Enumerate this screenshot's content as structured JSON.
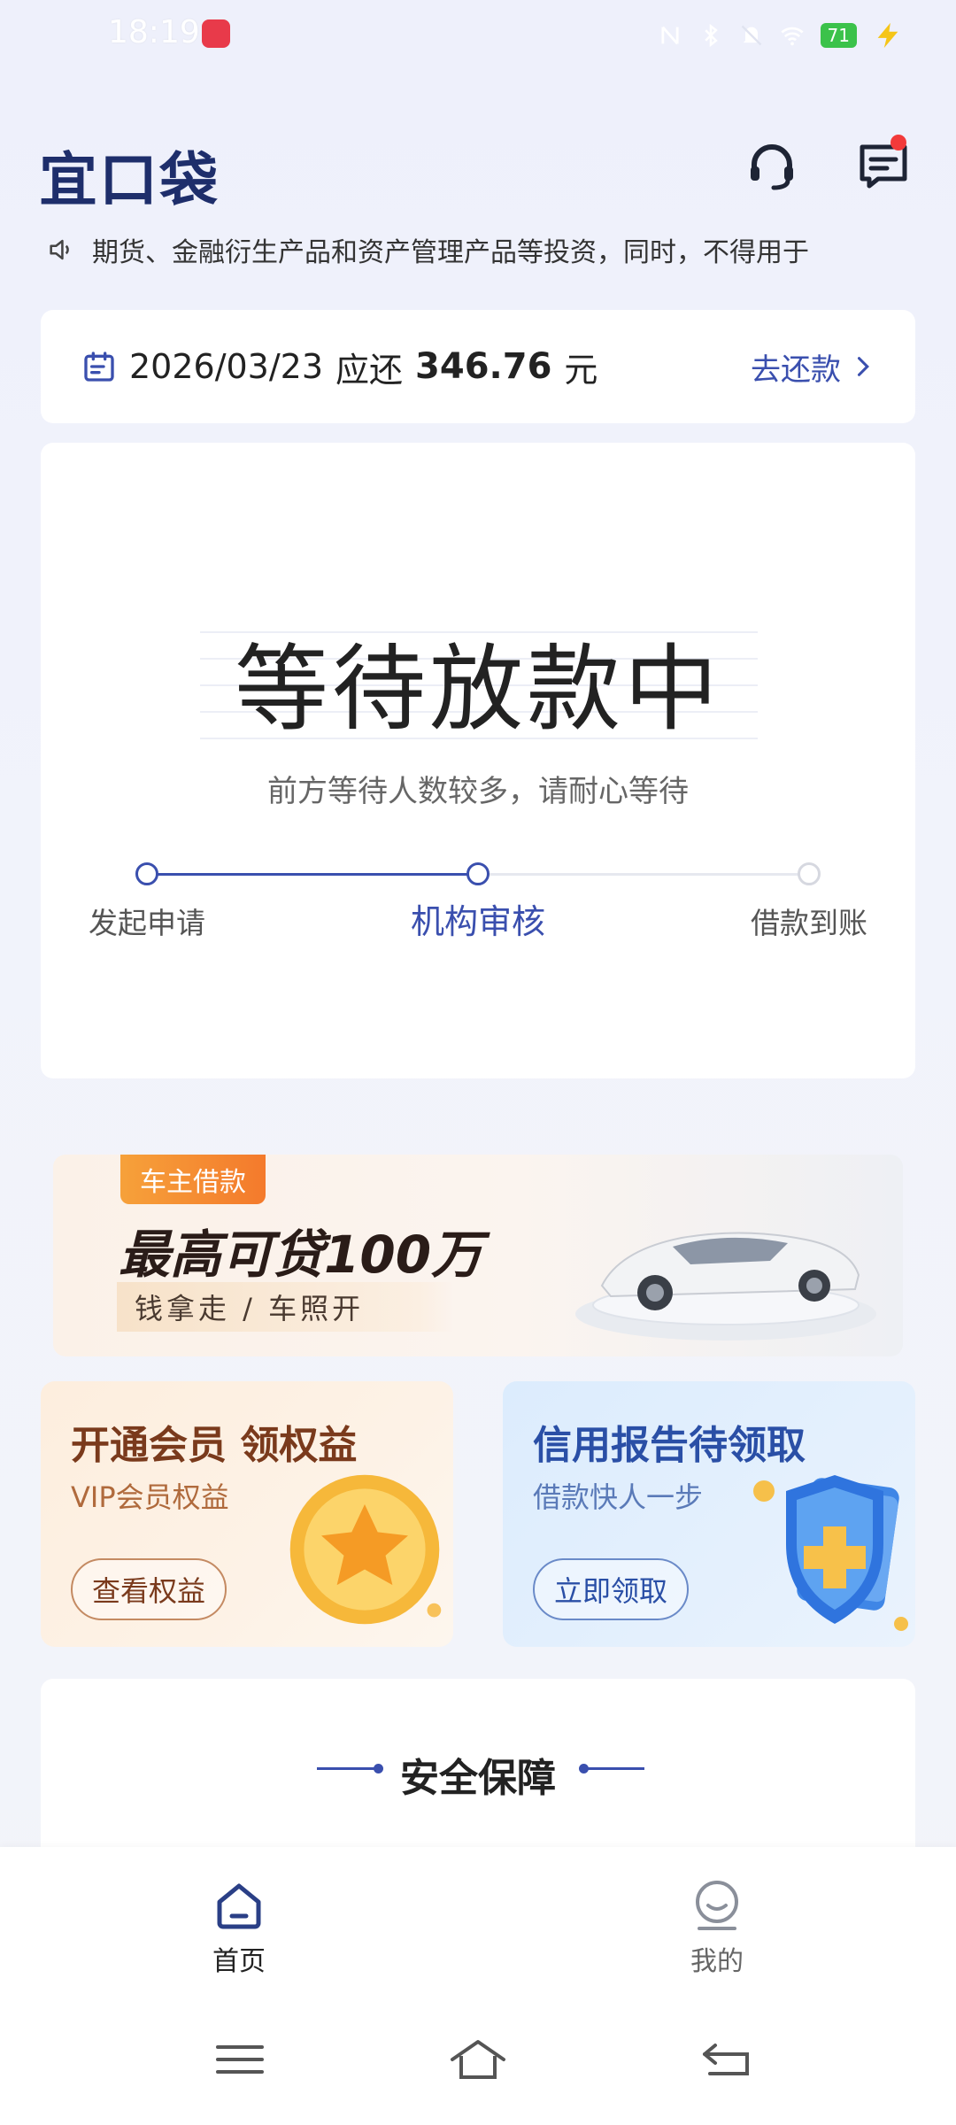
{
  "status_bar": {
    "time": "18:19",
    "battery": "71"
  },
  "header": {
    "logo": "宜口袋",
    "support_icon": "headset-icon",
    "message_icon": "message-icon"
  },
  "notice": {
    "icon": "speaker-icon",
    "text": "期货、金融衍生产品和资产管理产品等投资，同时，不得用于"
  },
  "repayment": {
    "date": "2026/03/23",
    "due_label": "应还",
    "amount": "346.76",
    "unit": "元",
    "action_label": "去还款"
  },
  "loan_status": {
    "title": "等待放款中",
    "subtitle": "前方等待人数较多，请耐心等待",
    "steps": [
      {
        "label": "发起申请",
        "state": "done"
      },
      {
        "label": "机构审核",
        "state": "current"
      },
      {
        "label": "借款到账",
        "state": "pending"
      }
    ]
  },
  "banner": {
    "tag": "车主借款",
    "title": "最高可贷100万",
    "subtitle": "钱拿走 / 车照开"
  },
  "promos": {
    "vip": {
      "title": "开通会员 领权益",
      "subtitle": "VIP会员权益",
      "button": "查看权益"
    },
    "credit": {
      "title": "信用报告待领取",
      "subtitle": "借款快人一步",
      "button": "立即领取"
    }
  },
  "security": {
    "title": "安全保障"
  },
  "bottom_nav": {
    "items": [
      {
        "label": "首页",
        "icon": "home-icon",
        "active": true
      },
      {
        "label": "我的",
        "icon": "profile-icon",
        "active": false
      }
    ]
  },
  "colors": {
    "accent": "#3a4fae",
    "brand_dark": "#1e2e6b",
    "notification_dot": "#f23a3a"
  }
}
